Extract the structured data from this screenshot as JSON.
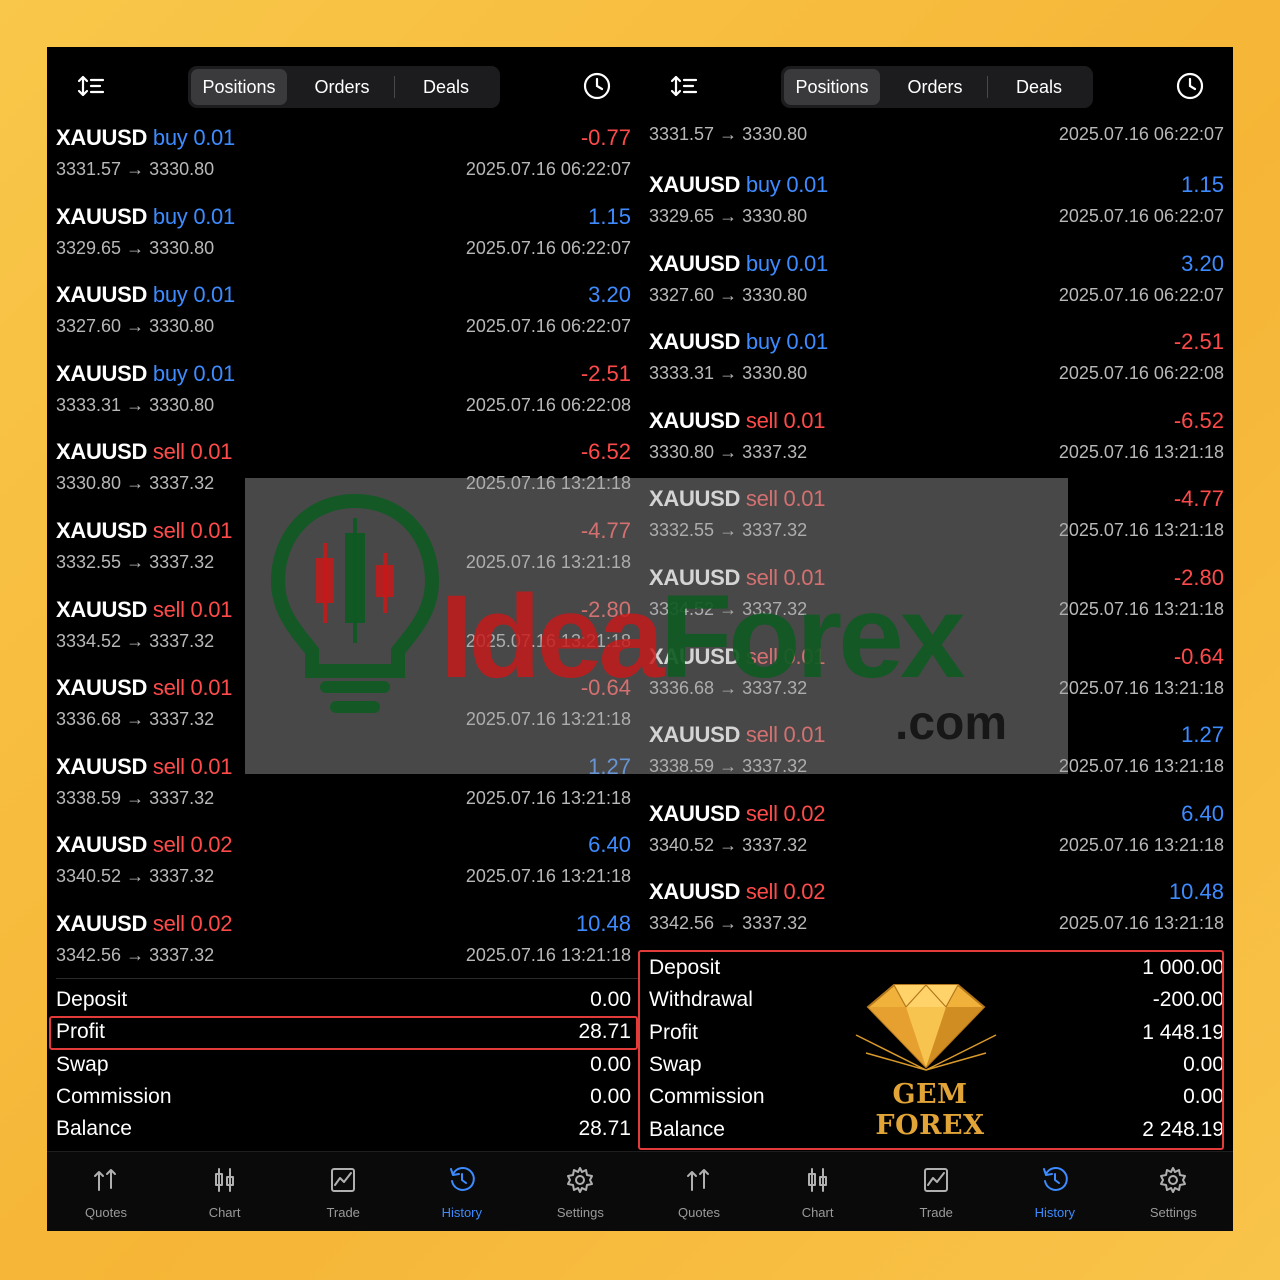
{
  "left": {
    "tabs": [
      "Positions",
      "Orders",
      "Deals"
    ],
    "items": [
      {
        "symbol": "XAUUSD",
        "side": "buy",
        "volume": "0.01",
        "profit": "-0.77",
        "prices": "3331.57 → 3330.80",
        "time": "2025.07.16 06:22:07"
      },
      {
        "symbol": "XAUUSD",
        "side": "buy",
        "volume": "0.01",
        "profit": "1.15",
        "prices": "3329.65 → 3330.80",
        "time": "2025.07.16 06:22:07"
      },
      {
        "symbol": "XAUUSD",
        "side": "buy",
        "volume": "0.01",
        "profit": "3.20",
        "prices": "3327.60 → 3330.80",
        "time": "2025.07.16 06:22:07"
      },
      {
        "symbol": "XAUUSD",
        "side": "buy",
        "volume": "0.01",
        "profit": "-2.51",
        "prices": "3333.31 → 3330.80",
        "time": "2025.07.16 06:22:08"
      },
      {
        "symbol": "XAUUSD",
        "side": "sell",
        "volume": "0.01",
        "profit": "-6.52",
        "prices": "3330.80 → 3337.32",
        "time": "2025.07.16 13:21:18"
      },
      {
        "symbol": "XAUUSD",
        "side": "sell",
        "volume": "0.01",
        "profit": "-4.77",
        "prices": "3332.55 → 3337.32",
        "time": "2025.07.16 13:21:18"
      },
      {
        "symbol": "XAUUSD",
        "side": "sell",
        "volume": "0.01",
        "profit": "-2.80",
        "prices": "3334.52 → 3337.32",
        "time": "2025.07.16 13:21:18"
      },
      {
        "symbol": "XAUUSD",
        "side": "sell",
        "volume": "0.01",
        "profit": "-0.64",
        "prices": "3336.68 → 3337.32",
        "time": "2025.07.16 13:21:18"
      },
      {
        "symbol": "XAUUSD",
        "side": "sell",
        "volume": "0.01",
        "profit": "1.27",
        "prices": "3338.59 → 3337.32",
        "time": "2025.07.16 13:21:18"
      },
      {
        "symbol": "XAUUSD",
        "side": "sell",
        "volume": "0.02",
        "profit": "6.40",
        "prices": "3340.52 → 3337.32",
        "time": "2025.07.16 13:21:18"
      },
      {
        "symbol": "XAUUSD",
        "side": "sell",
        "volume": "0.02",
        "profit": "10.48",
        "prices": "3342.56 → 3337.32",
        "time": "2025.07.16 13:21:18"
      }
    ],
    "summary": [
      {
        "label": "Deposit",
        "value": "0.00"
      },
      {
        "label": "Profit",
        "value": "28.71"
      },
      {
        "label": "Swap",
        "value": "0.00"
      },
      {
        "label": "Commission",
        "value": "0.00"
      },
      {
        "label": "Balance",
        "value": "28.71"
      }
    ]
  },
  "right": {
    "tabs": [
      "Positions",
      "Orders",
      "Deals"
    ],
    "partial": {
      "prices": "3331.57 → 3330.80",
      "time": "2025.07.16 06:22:07"
    },
    "items": [
      {
        "symbol": "XAUUSD",
        "side": "buy",
        "volume": "0.01",
        "profit": "1.15",
        "prices": "3329.65 → 3330.80",
        "time": "2025.07.16 06:22:07"
      },
      {
        "symbol": "XAUUSD",
        "side": "buy",
        "volume": "0.01",
        "profit": "3.20",
        "prices": "3327.60 → 3330.80",
        "time": "2025.07.16 06:22:07"
      },
      {
        "symbol": "XAUUSD",
        "side": "buy",
        "volume": "0.01",
        "profit": "-2.51",
        "prices": "3333.31 → 3330.80",
        "time": "2025.07.16 06:22:08"
      },
      {
        "symbol": "XAUUSD",
        "side": "sell",
        "volume": "0.01",
        "profit": "-6.52",
        "prices": "3330.80 → 3337.32",
        "time": "2025.07.16 13:21:18"
      },
      {
        "symbol": "XAUUSD",
        "side": "sell",
        "volume": "0.01",
        "profit": "-4.77",
        "prices": "3332.55 → 3337.32",
        "time": "2025.07.16 13:21:18"
      },
      {
        "symbol": "XAUUSD",
        "side": "sell",
        "volume": "0.01",
        "profit": "-2.80",
        "prices": "3334.52 → 3337.32",
        "time": "2025.07.16 13:21:18"
      },
      {
        "symbol": "XAUUSD",
        "side": "sell",
        "volume": "0.01",
        "profit": "-0.64",
        "prices": "3336.68 → 3337.32",
        "time": "2025.07.16 13:21:18"
      },
      {
        "symbol": "XAUUSD",
        "side": "sell",
        "volume": "0.01",
        "profit": "1.27",
        "prices": "3338.59 → 3337.32",
        "time": "2025.07.16 13:21:18"
      },
      {
        "symbol": "XAUUSD",
        "side": "sell",
        "volume": "0.02",
        "profit": "6.40",
        "prices": "3340.52 → 3337.32",
        "time": "2025.07.16 13:21:18"
      },
      {
        "symbol": "XAUUSD",
        "side": "sell",
        "volume": "0.02",
        "profit": "10.48",
        "prices": "3342.56 → 3337.32",
        "time": "2025.07.16 13:21:18"
      }
    ],
    "summary": [
      {
        "label": "Deposit",
        "value": "1 000.00"
      },
      {
        "label": "Withdrawal",
        "value": "-200.00"
      },
      {
        "label": "Profit",
        "value": "1 448.19"
      },
      {
        "label": "Swap",
        "value": "0.00"
      },
      {
        "label": "Commission",
        "value": "0.00"
      },
      {
        "label": "Balance",
        "value": "2 248.19"
      }
    ]
  },
  "nav": [
    {
      "label": "Quotes",
      "icon": "quotes-icon"
    },
    {
      "label": "Chart",
      "icon": "chart-icon"
    },
    {
      "label": "Trade",
      "icon": "trade-icon"
    },
    {
      "label": "History",
      "icon": "history-icon",
      "active": true
    },
    {
      "label": "Settings",
      "icon": "settings-icon"
    }
  ],
  "watermark": {
    "text_part1": "Idea",
    "text_part2": "Forex",
    "text_suffix": ".com"
  },
  "gem_logo": {
    "text": "GEM FOREX"
  },
  "colors": {
    "buy": "#3d8bff",
    "sell": "#ff4a4a",
    "highlight": "#e33a3a",
    "accent": "#3d8bff"
  }
}
